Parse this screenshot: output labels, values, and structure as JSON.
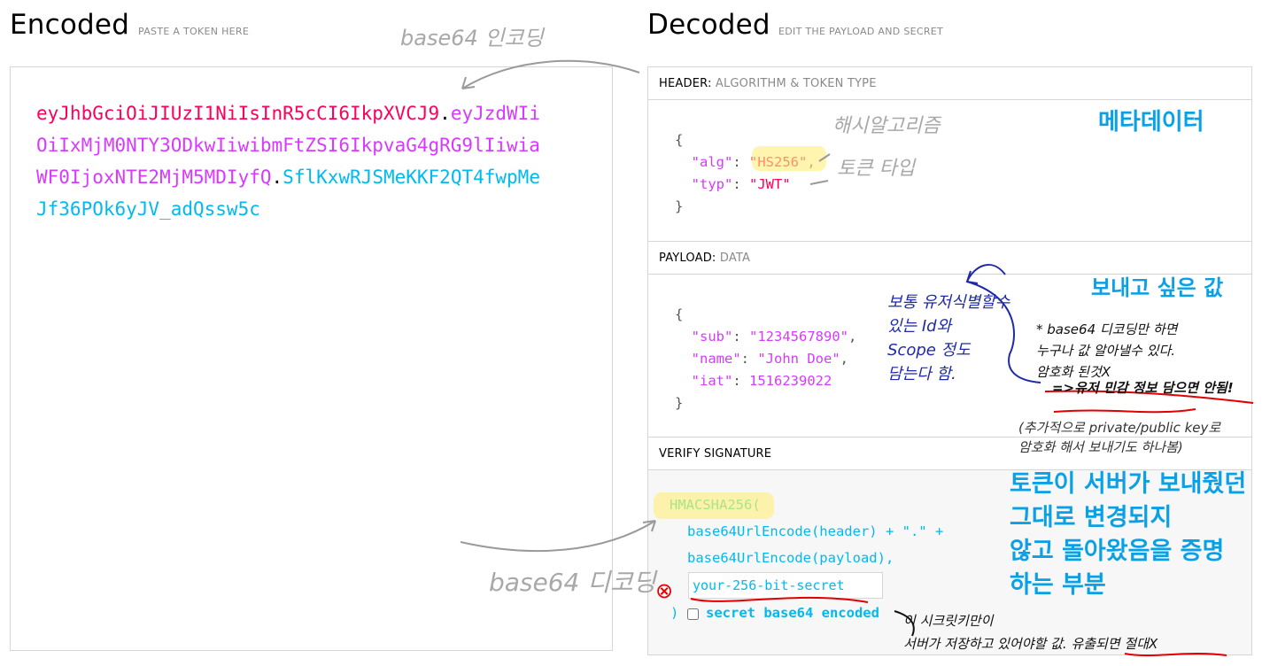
{
  "encoded": {
    "title": "Encoded",
    "subtitle": "PASTE A TOKEN HERE",
    "header_part": "eyJhbGciOiJIUzI1NiIsInR5cCI6IkpXVCJ9",
    "dot1": ".",
    "payload_part": "eyJzdWIiOiIxMjM0NTY3ODkwIiwibmFtZSI6IkpvaG4gRG9lIiwiaWF0IjoxNTE2MjM5MDIyfQ",
    "dot2": ".",
    "signature_part": "SflKxwRJSMeKKF2QT4fwpMeJf36POk6yJV_adQssw5c"
  },
  "decoded": {
    "title": "Decoded",
    "subtitle": "EDIT THE PAYLOAD AND SECRET",
    "header": {
      "label": "HEADER:",
      "desc": "ALGORITHM & TOKEN TYPE",
      "open": "{",
      "close": "}",
      "alg_key": "\"alg\"",
      "alg_val": "\"HS256\"",
      "typ_key": "\"typ\"",
      "typ_val": "\"JWT\""
    },
    "payload": {
      "label": "PAYLOAD:",
      "desc": "DATA",
      "open": "{",
      "close": "}",
      "sub_key": "\"sub\"",
      "sub_val": "\"1234567890\"",
      "name_key": "\"name\"",
      "name_val": "\"John Doe\"",
      "iat_key": "\"iat\"",
      "iat_val": "1516239022"
    },
    "signature": {
      "label": "VERIFY SIGNATURE",
      "fn": "HMACSHA256(",
      "line1": "base64UrlEncode(header) + \".\" +",
      "line2": "base64UrlEncode(payload),",
      "secret_value": "your-256-bit-secret",
      "close_paren": ")",
      "checkbox_label": "secret base64 encoded"
    }
  },
  "annotations": {
    "encoding_note": "base64 인코딩",
    "decoding_note": "base64 디코딩",
    "alg_note": "해시알고리즘",
    "typ_note": "토큰 타입",
    "metadata_note": "메타데이터",
    "payload_note": "보통 유저식별할수\n있는 Id와\nScope 정도\n담는다 함.",
    "values_note": "보내고 싶은 값",
    "b64_note": "* base64 디코딩만 하면\n누구나 값 알아낼수 있다.\n암호화 된것X",
    "warning_note": "=>유저 민감 정보 담으면 안됨!",
    "extra_note": "(추가적으로 private/public key로\n암호화 해서 보내기도 하나봄)",
    "signature_note": "토큰이 서버가 보내줬던\n그대로 변경되지\n않고 돌아왔음을 증명\n하는 부분",
    "secret_note": "이 시크릿키만이\n서버가 저장하고 있어야할 값. 유출되면 절대X",
    "x_mark": "⊗"
  }
}
